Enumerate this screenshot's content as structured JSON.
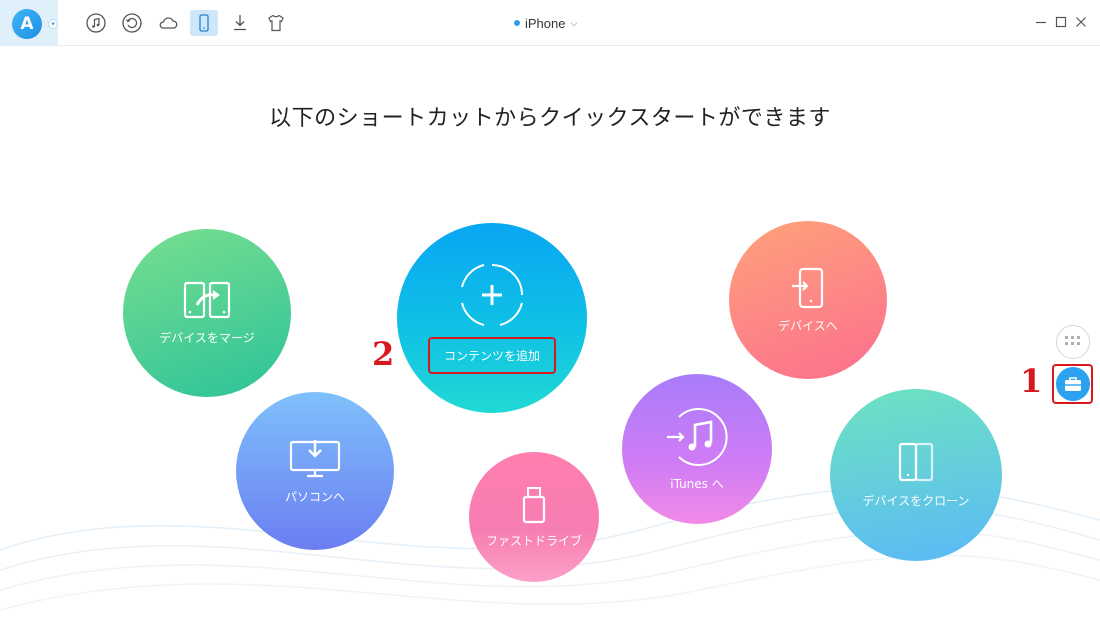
{
  "app": {
    "logo_letter": "A",
    "accent_color": "#2b9cf0"
  },
  "toolbar": {
    "items": [
      {
        "name": "music-icon"
      },
      {
        "name": "restore-icon"
      },
      {
        "name": "cloud-icon"
      },
      {
        "name": "device-icon",
        "active": true
      },
      {
        "name": "download-icon"
      },
      {
        "name": "tshirt-icon"
      }
    ]
  },
  "device": {
    "name": "iPhone",
    "caret": "⌵"
  },
  "heading": "以下のショートカットからクイックスタートができます",
  "shortcuts": {
    "merge": "デバイスをマージ",
    "add_content": "コンテンツを追加",
    "to_device": "デバイスへ",
    "to_pc": "パソコンへ",
    "fast_drive": "ファストドライブ",
    "to_itunes": "iTunes へ",
    "clone": "デバイスをクローン"
  },
  "annotations": {
    "step1": "1",
    "step2": "2",
    "highlight_color": "#d7191f"
  }
}
